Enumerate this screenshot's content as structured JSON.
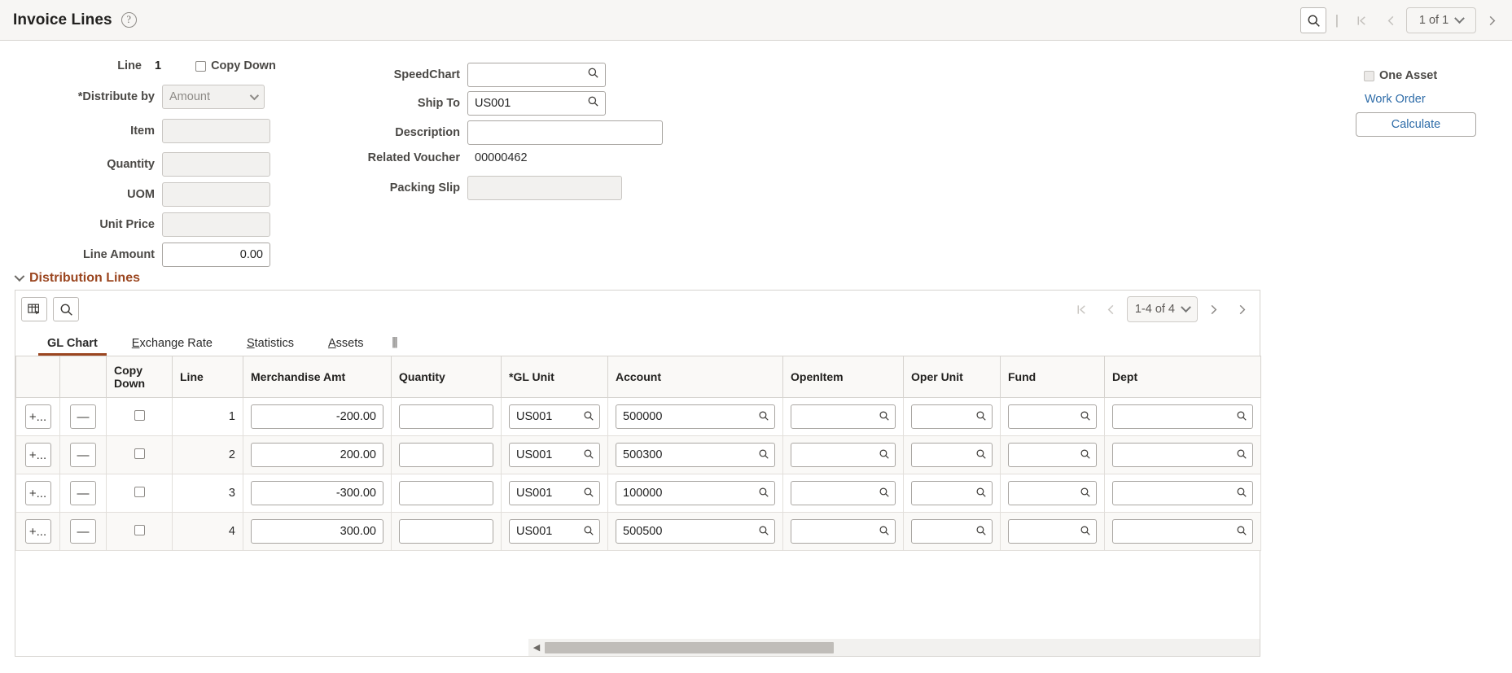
{
  "header": {
    "title": "Invoice Lines",
    "help_icon": "question-mark-icon",
    "search_icon": "search-icon",
    "divider": "|",
    "first_icon": "|<",
    "prev_icon": "<",
    "pager_label": "1 of 1",
    "next_icon": ">"
  },
  "form": {
    "line_label": "Line",
    "line_value": "1",
    "copy_down_label": "Copy Down",
    "distribute_by_label": "*Distribute by",
    "distribute_by_value": "Amount",
    "item_label": "Item",
    "item_value": "",
    "quantity_label": "Quantity",
    "quantity_value": "",
    "uom_label": "UOM",
    "uom_value": "",
    "unit_price_label": "Unit Price",
    "unit_price_value": "",
    "line_amount_label": "Line Amount",
    "line_amount_value": "0.00",
    "speedchart_label": "SpeedChart",
    "speedchart_value": "",
    "ship_to_label": "Ship To",
    "ship_to_value": "US001",
    "description_label": "Description",
    "description_value": "",
    "related_voucher_label": "Related Voucher",
    "related_voucher_value": "00000462",
    "packing_slip_label": "Packing Slip",
    "packing_slip_value": "",
    "one_asset_label": "One Asset",
    "work_order_label": "Work Order",
    "calculate_label": "Calculate"
  },
  "distribution": {
    "section_title": "Distribution Lines",
    "grid_icon": "grid-personalize-icon",
    "search_icon": "search-icon",
    "pager": {
      "first_icon": "|<",
      "prev_icon": "<",
      "label": "1-4 of 4",
      "next_icon": ">",
      "last_icon": ">|"
    },
    "tabs": [
      {
        "label": "GL Chart",
        "accesskey": "",
        "active": true
      },
      {
        "label": "Exchange Rate",
        "accesskey": "E",
        "active": false
      },
      {
        "label": "Statistics",
        "accesskey": "S",
        "active": false
      },
      {
        "label": "Assets",
        "accesskey": "A",
        "active": false
      }
    ],
    "tab_more_icon": "more-tabs-icon",
    "columns": [
      "",
      "",
      "Copy Down",
      "Line",
      "Merchandise Amt",
      "Quantity",
      "*GL Unit",
      "Account",
      "OpenItem",
      "Oper Unit",
      "Fund",
      "Dept"
    ],
    "add_label": "+...",
    "delete_label": "—",
    "rows": [
      {
        "line": "1",
        "merchandise_amt": "-200.00",
        "quantity": "",
        "gl_unit": "US001",
        "account": "500000",
        "open_item": "",
        "oper_unit": "",
        "fund": "",
        "dept": ""
      },
      {
        "line": "2",
        "merchandise_amt": "200.00",
        "quantity": "",
        "gl_unit": "US001",
        "account": "500300",
        "open_item": "",
        "oper_unit": "",
        "fund": "",
        "dept": ""
      },
      {
        "line": "3",
        "merchandise_amt": "-300.00",
        "quantity": "",
        "gl_unit": "US001",
        "account": "100000",
        "open_item": "",
        "oper_unit": "",
        "fund": "",
        "dept": ""
      },
      {
        "line": "4",
        "merchandise_amt": "300.00",
        "quantity": "",
        "gl_unit": "US001",
        "account": "500500",
        "open_item": "",
        "oper_unit": "",
        "fund": "",
        "dept": ""
      }
    ],
    "scroll_left_icon": "scroll-left-arrow-icon"
  },
  "colors": {
    "accent": "#9b4620",
    "link": "#2e6ca8",
    "header_bg": "#f7f6f4"
  }
}
